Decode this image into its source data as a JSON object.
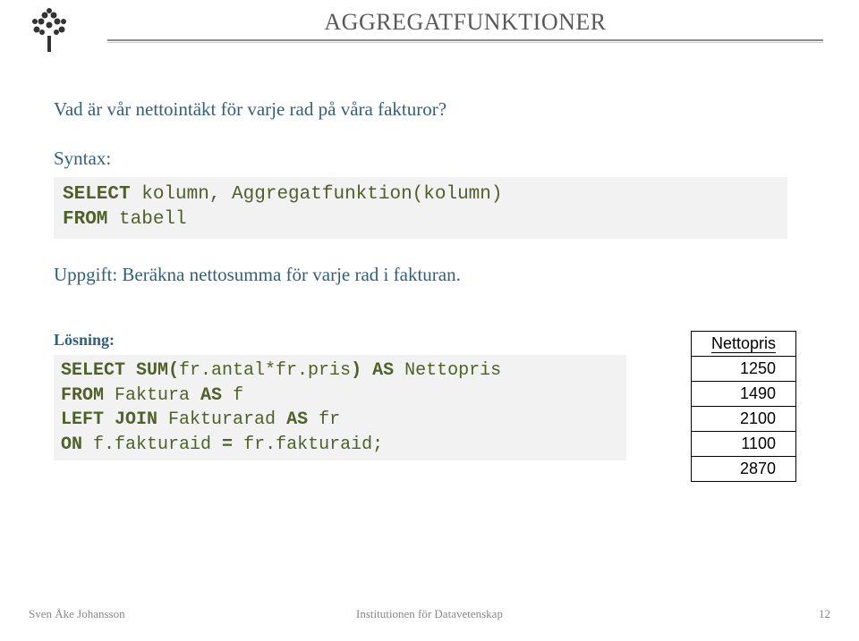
{
  "title": "AGGREGATFUNKTIONER",
  "intro": "Vad är vår nettointäkt för varje rad på våra fakturor?",
  "syntax": {
    "label": "Syntax:",
    "line1_kw1": "SELECT",
    "line1_rest": " kolumn, Aggregatfunktion(kolumn)",
    "line2_kw1": "FROM",
    "line2_rest": " tabell"
  },
  "uppgift": "Uppgift: Beräkna nettosumma för varje rad i fakturan.",
  "solution": {
    "label": "Lösning:",
    "l1_kw1": "SELECT SUM(",
    "l1_rest1": "fr.antal*fr.pris",
    "l1_kw2": ") AS",
    "l1_rest2": " Nettopris",
    "l2_kw1": "FROM",
    "l2_rest1": " Faktura ",
    "l2_kw2": "AS",
    "l2_rest2": " f",
    "l3_kw1": "LEFT JOIN",
    "l3_rest1": " Fakturarad ",
    "l3_kw2": "AS",
    "l3_rest2": " fr",
    "l4_kw1": "ON",
    "l4_rest1": " f.fakturaid ",
    "l4_kw2": "=",
    "l4_rest2": " fr.fakturaid;"
  },
  "table": {
    "header": "Nettopris",
    "rows": [
      "1250",
      "1490",
      "2100",
      "1100",
      "2870"
    ]
  },
  "footer": {
    "left": "Sven Åke Johansson",
    "center": "Institutionen för Datavetenskap",
    "right": "12"
  }
}
